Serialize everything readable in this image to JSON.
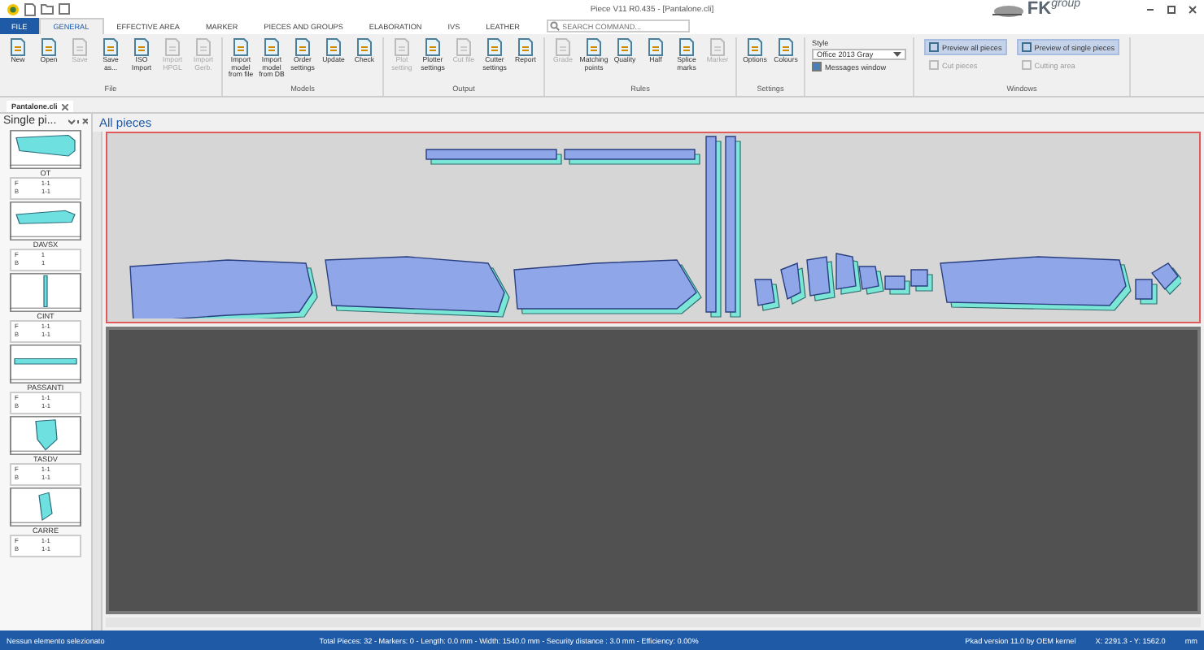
{
  "window": {
    "title": "Piece V11 R0.435 - [Pantalone.cli]",
    "brand": "FK",
    "brand_suffix": "group"
  },
  "tabs": [
    {
      "label": "FILE",
      "kind": "file",
      "selected": false
    },
    {
      "label": "GENERAL",
      "kind": "tab",
      "selected": true
    },
    {
      "label": "EFFECTIVE AREA",
      "kind": "tab",
      "selected": false
    },
    {
      "label": "MARKER",
      "kind": "tab",
      "selected": false
    },
    {
      "label": "PIECES AND GROUPS",
      "kind": "tab",
      "selected": false
    },
    {
      "label": "ELABORATION",
      "kind": "tab",
      "selected": false
    },
    {
      "label": "IVS",
      "kind": "tab",
      "selected": false
    },
    {
      "label": "LEATHER",
      "kind": "tab",
      "selected": false
    }
  ],
  "search": {
    "placeholder": "SEARCH COMMAND..."
  },
  "ribbon_groups": [
    {
      "title": "File",
      "buttons": [
        {
          "label": "New",
          "disabled": false
        },
        {
          "label": "Open",
          "disabled": false
        },
        {
          "label": "Save",
          "disabled": true
        },
        {
          "label": "Save as...",
          "disabled": false
        },
        {
          "label": "ISO Import",
          "disabled": false
        },
        {
          "label": "Import HPGL",
          "disabled": true
        },
        {
          "label": "Import Gerb.",
          "disabled": true
        }
      ]
    },
    {
      "title": "Models",
      "buttons": [
        {
          "label": "Import model from file",
          "disabled": false
        },
        {
          "label": "Import model from DB",
          "disabled": false
        },
        {
          "label": "Order settings",
          "disabled": false
        },
        {
          "label": "Update",
          "disabled": false
        },
        {
          "label": "Check",
          "disabled": false
        }
      ]
    },
    {
      "title": "Output",
      "buttons": [
        {
          "label": "Plot setting",
          "disabled": true
        },
        {
          "label": "Plotter settings",
          "disabled": false
        },
        {
          "label": "Cut file",
          "disabled": true
        },
        {
          "label": "Cutter settings",
          "disabled": false
        },
        {
          "label": "Report",
          "disabled": false
        }
      ]
    },
    {
      "title": "Rules",
      "buttons": [
        {
          "label": "Grade",
          "disabled": true
        },
        {
          "label": "Matching points",
          "disabled": false
        },
        {
          "label": "Quality",
          "disabled": false
        },
        {
          "label": "Half",
          "disabled": false
        },
        {
          "label": "Splice marks",
          "disabled": false
        },
        {
          "label": "Marker",
          "disabled": true
        }
      ]
    },
    {
      "title": "Settings",
      "buttons": [
        {
          "label": "Options",
          "disabled": false
        },
        {
          "label": "Colours",
          "disabled": false
        }
      ]
    }
  ],
  "style_group": {
    "label": "Style",
    "value": "Office 2013 Gray",
    "messages": {
      "label": "Messages window",
      "checked": true
    }
  },
  "windows_group": {
    "title": "Windows",
    "items": [
      {
        "label": "Preview all pieces",
        "selected": true,
        "disabled": false
      },
      {
        "label": "Preview of single pieces",
        "selected": true,
        "disabled": false
      },
      {
        "label": "Cut pieces",
        "selected": false,
        "disabled": true
      },
      {
        "label": "Cutting area",
        "selected": false,
        "disabled": true
      }
    ]
  },
  "document_tab": {
    "label": "Pantalone.cli"
  },
  "side_panel": {
    "title": "Single pi...",
    "pieces": [
      {
        "name": "OT",
        "rows": [
          {
            "key": "F",
            "value": "1-1"
          },
          {
            "key": "B",
            "value": "1-1"
          }
        ]
      },
      {
        "name": "DAVSX",
        "rows": [
          {
            "key": "F",
            "value": "1"
          },
          {
            "key": "B",
            "value": "1"
          }
        ]
      },
      {
        "name": "CINT",
        "rows": [
          {
            "key": "F",
            "value": "1-1"
          },
          {
            "key": "B",
            "value": "1-1"
          }
        ]
      },
      {
        "name": "PASSANTI",
        "rows": [
          {
            "key": "F",
            "value": "1-1"
          },
          {
            "key": "B",
            "value": "1-1"
          }
        ]
      },
      {
        "name": "TASDV",
        "rows": [
          {
            "key": "F",
            "value": "1-1"
          },
          {
            "key": "B",
            "value": "1-1"
          }
        ]
      },
      {
        "name": "CARRE",
        "rows": [
          {
            "key": "F",
            "value": "1-1"
          },
          {
            "key": "B",
            "value": "1-1"
          }
        ]
      }
    ]
  },
  "main_view": {
    "title": "All pieces"
  },
  "status_bar": {
    "selection": "Nessun elemento selezionato",
    "summary": "Total Pieces: 32 - Markers: 0 - Length: 0.0 mm - Width: 1540.0 mm - Security distance : 3.0 mm - Efficiency: 0.00%",
    "version": "Pkad version 11.0 by OEM kernel",
    "coordinates": "X: 2291.3 - Y: 1562.0",
    "unit": "mm"
  }
}
